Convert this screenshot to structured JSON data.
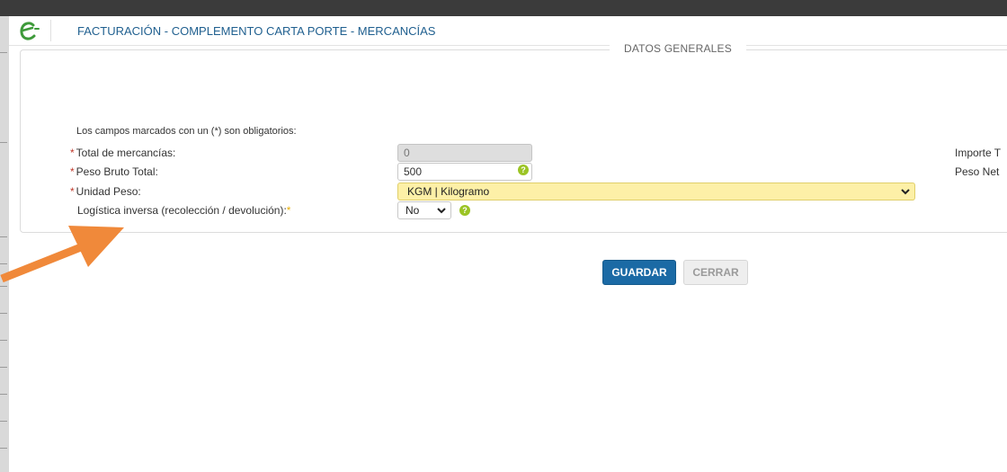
{
  "header": {
    "title": "FACTURACIÓN - COMPLEMENTO CARTA PORTE - MERCANCÍAS"
  },
  "section": {
    "legend": "DATOS GENERALES",
    "required_note": "Los campos marcados con un (*) son obligatorios:"
  },
  "fields": {
    "total_mercancias": {
      "asterisk": "*",
      "label": "Total de mercancías:",
      "value": "0"
    },
    "peso_bruto": {
      "asterisk": "*",
      "label": "Peso Bruto Total:",
      "value": "500"
    },
    "unidad_peso": {
      "asterisk": "*",
      "label": "Unidad Peso:",
      "value": "KGM | Kilogramo"
    },
    "logistica": {
      "label": "Logística inversa (recolección / devolución):",
      "asterisk": "*",
      "value": "No"
    }
  },
  "right_labels": {
    "importe": "Importe T",
    "peso_neto": "Peso Net"
  },
  "buttons": {
    "guardar": "GUARDAR",
    "cerrar": "CERRAR"
  },
  "icons": {
    "help": "?"
  },
  "colors": {
    "accent": "#1b6aa5",
    "title": "#1f5f8f",
    "highlight_select": "#fdf0a7",
    "help_icon": "#9bc424",
    "annotation_arrow": "#f0893a"
  }
}
